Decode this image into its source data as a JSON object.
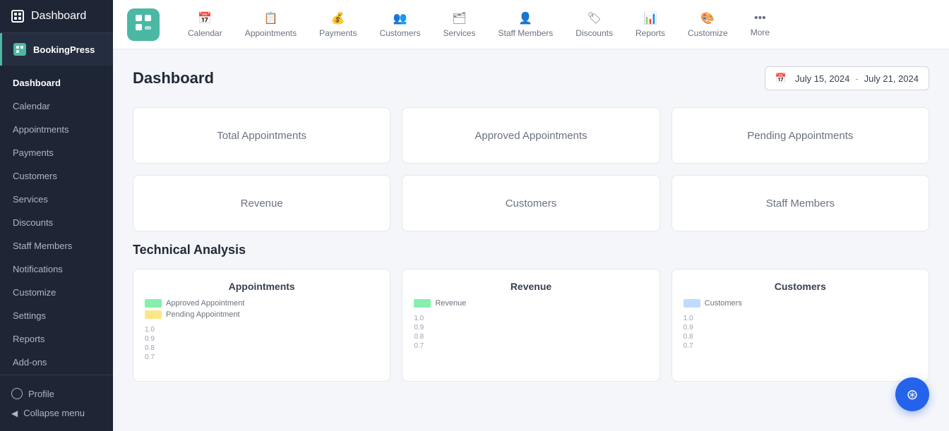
{
  "sidebar": {
    "dashboard_label": "Dashboard",
    "brand_label": "BookingPress",
    "nav_items": [
      {
        "label": "Dashboard",
        "active": true
      },
      {
        "label": "Calendar",
        "active": false
      },
      {
        "label": "Appointments",
        "active": false
      },
      {
        "label": "Payments",
        "active": false
      },
      {
        "label": "Customers",
        "active": false
      },
      {
        "label": "Services",
        "active": false
      },
      {
        "label": "Discounts",
        "active": false
      },
      {
        "label": "Staff Members",
        "active": false
      },
      {
        "label": "Notifications",
        "active": false
      },
      {
        "label": "Customize",
        "active": false
      },
      {
        "label": "Settings",
        "active": false
      },
      {
        "label": "Reports",
        "active": false
      },
      {
        "label": "Add-ons",
        "active": false
      }
    ],
    "profile_label": "Profile",
    "collapse_label": "Collapse menu"
  },
  "topbar": {
    "nav_items": [
      {
        "label": "Calendar",
        "icon": "📅"
      },
      {
        "label": "Appointments",
        "icon": "📋"
      },
      {
        "label": "Payments",
        "icon": "💰"
      },
      {
        "label": "Customers",
        "icon": "👥"
      },
      {
        "label": "Services",
        "icon": "🗂"
      },
      {
        "label": "Staff Members",
        "icon": "👤"
      },
      {
        "label": "Discounts",
        "icon": "🏷"
      },
      {
        "label": "Reports",
        "icon": "📊"
      },
      {
        "label": "Customize",
        "icon": "🎨"
      },
      {
        "label": "More",
        "icon": "•••"
      }
    ]
  },
  "content": {
    "title": "Dashboard",
    "date_start": "July 15, 2024",
    "date_end": "July 21, 2024",
    "stat_cards": [
      {
        "label": "Total Appointments"
      },
      {
        "label": "Approved Appointments"
      },
      {
        "label": "Pending Appointments"
      },
      {
        "label": "Revenue"
      },
      {
        "label": "Customers"
      },
      {
        "label": "Staff Members"
      }
    ],
    "technical_analysis_title": "Technical Analysis",
    "charts": [
      {
        "title": "Appointments",
        "legend": [
          {
            "label": "Approved Appointment",
            "color": "#86efac"
          },
          {
            "label": "Pending Appointment",
            "color": "#fde68a"
          }
        ],
        "y_labels": [
          "1.0",
          "0.9",
          "0.8",
          "0.7"
        ]
      },
      {
        "title": "Revenue",
        "legend": [
          {
            "label": "Revenue",
            "color": "#86efac"
          }
        ],
        "y_labels": [
          "1.0",
          "0.9",
          "0.8",
          "0.7"
        ]
      },
      {
        "title": "Customers",
        "legend": [
          {
            "label": "Customers",
            "color": "#bfdbfe"
          }
        ],
        "y_labels": [
          "1.0",
          "0.9",
          "0.8",
          "0.7"
        ]
      }
    ]
  }
}
